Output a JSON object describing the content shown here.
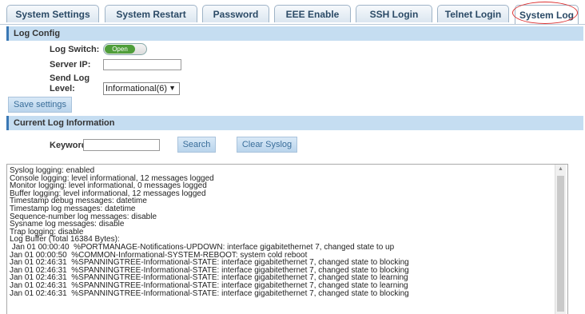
{
  "tabs": [
    {
      "label": "System Settings",
      "active": false
    },
    {
      "label": "System Restart",
      "active": false
    },
    {
      "label": "Password",
      "active": false
    },
    {
      "label": "EEE Enable",
      "active": false
    },
    {
      "label": "SSH Login",
      "active": false
    },
    {
      "label": "Telnet Login",
      "active": false
    },
    {
      "label": "System Log",
      "active": true
    }
  ],
  "log_config": {
    "header": "Log Config",
    "log_switch_label": "Log Switch:",
    "log_switch_value": "Open",
    "server_ip_label": "Server IP:",
    "server_ip_value": "",
    "send_log_label_1": "Send Log",
    "send_log_label_2": "Level:",
    "send_log_value": "Informational(6)",
    "save_button": "Save settings"
  },
  "current_log": {
    "header": "Current Log Information",
    "keyword_label": "Keyword",
    "keyword_value": "",
    "search_button": "Search",
    "clear_button": "Clear Syslog"
  },
  "log_lines": [
    "Syslog logging: enabled",
    "Console logging: level informational, 12 messages logged",
    "Monitor logging: level informational, 0 messages logged",
    "Buffer logging: level informational, 12 messages logged",
    "Timestamp debug messages: datetime",
    "Timestamp log messages: datetime",
    "Sequence-number log messages: disable",
    "Sysname log messages: disable",
    "Trap logging: disable",
    "Log Buffer (Total 16384 Bytes):",
    " Jan 01 00:00:40  %PORTMANAGE-Notifications-UPDOWN: interface gigabitethernet 7, changed state to up",
    "Jan 01 00:00:50  %COMMON-Informational-SYSTEM-REBOOT: system cold reboot",
    "Jan 01 02:46:31  %SPANNINGTREE-Informational-STATE: interface gigabitethernet 7, changed state to blocking",
    "Jan 01 02:46:31  %SPANNINGTREE-Informational-STATE: interface gigabitethernet 7, changed state to blocking",
    "Jan 01 02:46:31  %SPANNINGTREE-Informational-STATE: interface gigabitethernet 7, changed state to learning",
    "Jan 01 02:46:31  %SPANNINGTREE-Informational-STATE: interface gigabitethernet 7, changed state to learning",
    "Jan 01 02:46:31  %SPANNINGTREE-Informational-STATE: interface gigabitethernet 7, changed state to blocking"
  ],
  "colors": {
    "section_header_bg": "#c5ddf1",
    "section_accent": "#3a78b5",
    "toggle_on": "#4f9e3a",
    "tab_highlight": "#dd3333"
  },
  "icons": {
    "select_arrow": "dropdown-arrow-icon",
    "scroll_up": "scroll-up-icon"
  }
}
